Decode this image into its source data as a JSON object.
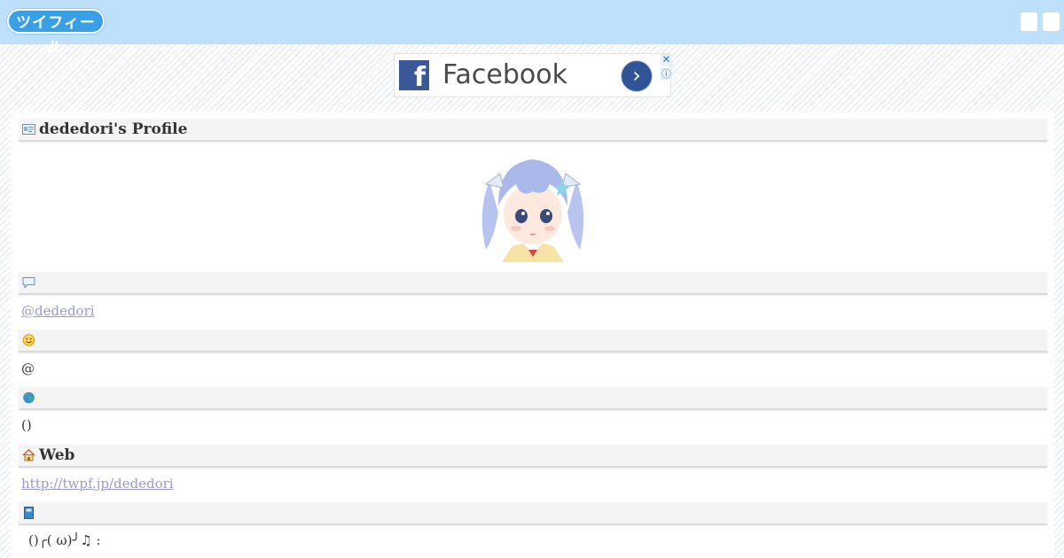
{
  "header": {
    "logo_text": "ツイフィール"
  },
  "ad": {
    "title": "Facebook",
    "go_symbol": "›",
    "close_symbol": "✕",
    "info_symbol": "ⓘ"
  },
  "profile": {
    "title": "dededori's Profile",
    "username_link": "@dededori",
    "name_value": "@",
    "location_value": "()",
    "web_title": "Web",
    "web_link": "http://twpf.jp/dededori",
    "bio_value": "()╭( ω)╯♫ :"
  },
  "colors": {
    "topbar": "#bfe0fb",
    "link": "#9a9ad1",
    "section_bg": "#f4f4f4"
  }
}
